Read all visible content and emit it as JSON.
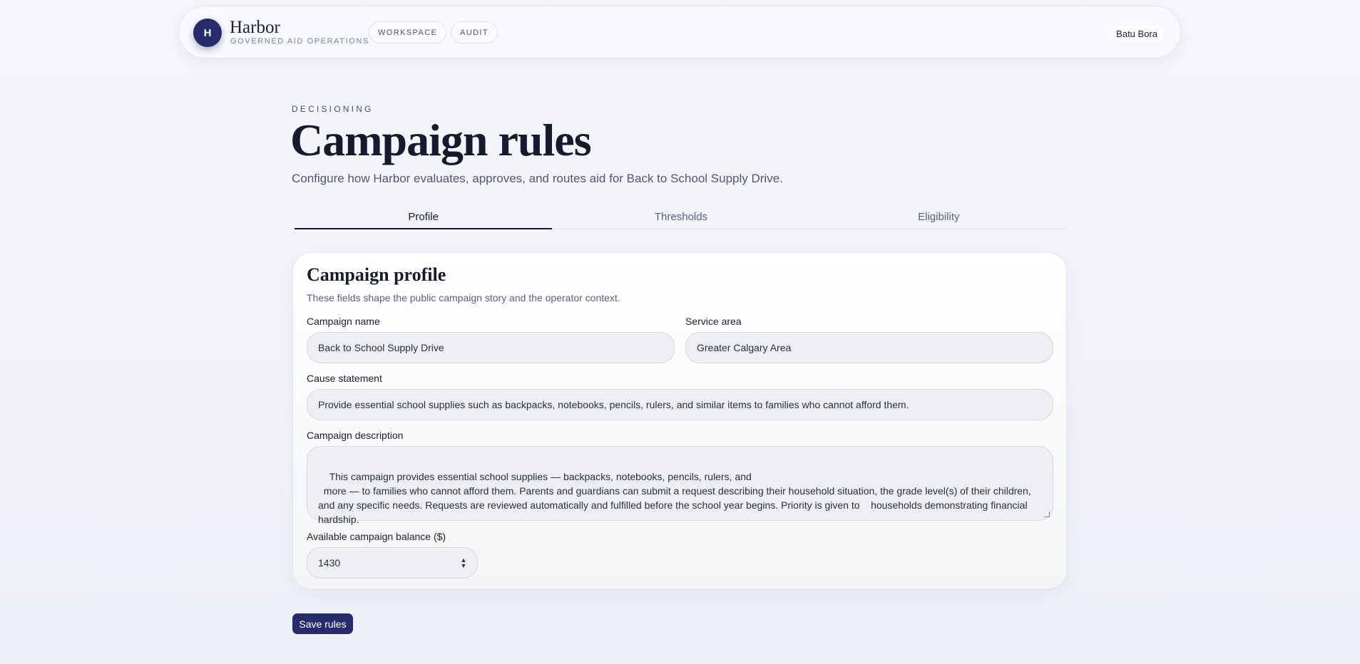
{
  "brand": {
    "initial": "H",
    "name": "Harbor",
    "subtitle": "GOVERNED AID OPERATIONS"
  },
  "nav": [
    {
      "label": "WORKSPACE"
    },
    {
      "label": "AUDIT"
    }
  ],
  "user": {
    "name": "Batu Bora"
  },
  "page": {
    "eyebrow": "DECISIONING",
    "title": "Campaign rules",
    "subtitle": "Configure how Harbor evaluates, approves, and routes aid for Back to School Supply Drive."
  },
  "tabs": [
    {
      "label": "Profile",
      "active": true
    },
    {
      "label": "Thresholds",
      "active": false
    },
    {
      "label": "Eligibility",
      "active": false
    }
  ],
  "card": {
    "title": "Campaign profile",
    "subtitle": "These fields shape the public campaign story and the operator context.",
    "fields": {
      "campaign_name": {
        "label": "Campaign name",
        "value": "Back to School Supply Drive"
      },
      "service_area": {
        "label": "Service area",
        "value": "Greater Calgary Area"
      },
      "cause_statement": {
        "label": "Cause statement",
        "value": "Provide essential school supplies such as backpacks, notebooks, pencils, rulers, and similar items to families who cannot afford them."
      },
      "description": {
        "label": "Campaign description",
        "value": "This campaign provides essential school supplies — backpacks, notebooks, pencils, rulers, and\n  more — to families who cannot afford them. Parents and guardians can submit a request describing their household situation, the grade level(s) of their children, and any specific needs. Requests are reviewed automatically and fulfilled before the school year begins. Priority is given to    households demonstrating financial hardship."
      },
      "balance": {
        "label": "Available campaign balance ($)",
        "value": "1430"
      }
    }
  },
  "actions": {
    "save_label": "Save rules"
  },
  "colors": {
    "accent": "#262b6b",
    "background": "#f2f3f8",
    "text": "#161a2e"
  }
}
